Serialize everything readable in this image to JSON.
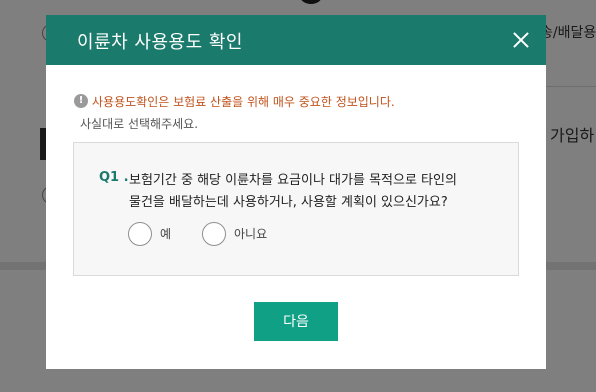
{
  "background": {
    "right_text_1": "송/배달용",
    "right_text_2": "가입하"
  },
  "modal": {
    "title": "이륜차 사용용도 확인",
    "close_icon": "close-icon",
    "notice": {
      "icon": "info-icon",
      "icon_glyph": "!",
      "line1": "사용용도확인은 보험료 산출을 위해 매우 중요한 정보입니다.",
      "line2": "사실대로 선택해주세요."
    },
    "question": {
      "number": "Q1 .",
      "text_line1": "보험기간 중 해당 이륜차를 요금이나 대가를 목적으로 타인의",
      "text_line2": "물건을 배달하는데 사용하거나, 사용할 계획이 있으신가요?",
      "options": [
        {
          "label": "예",
          "selected": false
        },
        {
          "label": "아니요",
          "selected": false
        }
      ]
    },
    "next_button": "다음"
  },
  "colors": {
    "header": "#1a7a6c",
    "button": "#10a085",
    "notice": "#c0531c",
    "question_number": "#1a7a6c"
  }
}
